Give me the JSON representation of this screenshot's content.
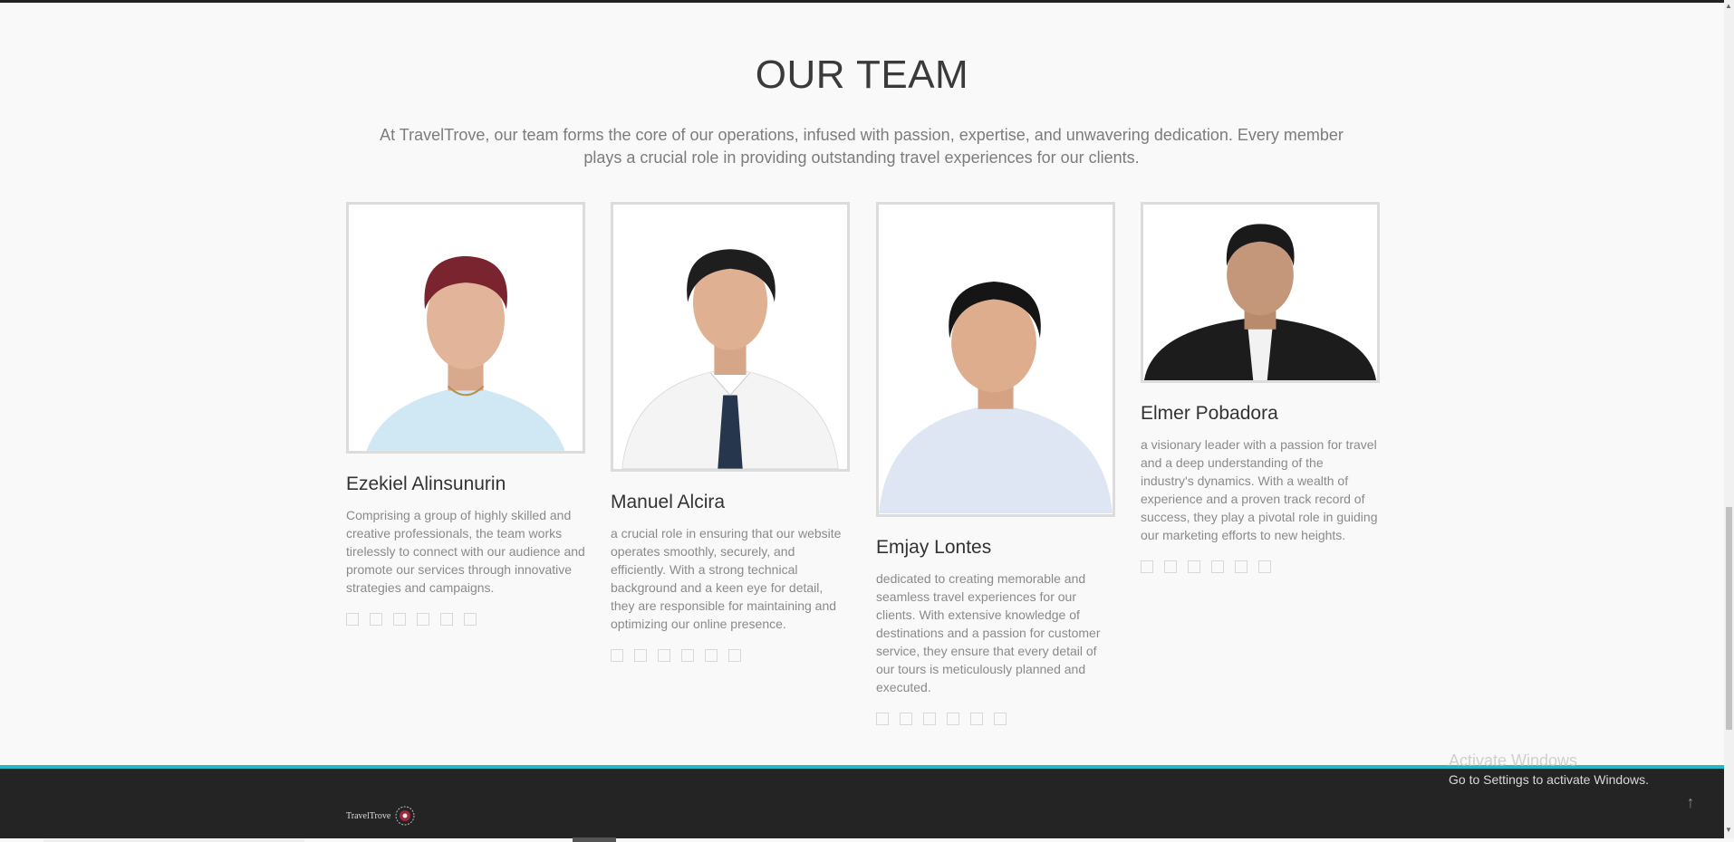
{
  "section": {
    "title": "OUR TEAM",
    "intro": "At TravelTrove, our team forms the core of our operations, infused with passion, expertise, and unwavering dedication. Every member plays a crucial role in providing outstanding travel experiences for our clients."
  },
  "members": [
    {
      "name": "Ezekiel Alinsunurin",
      "bio": "Comprising a group of highly skilled and creative professionals, the team works tirelessly to connect with our audience and promote our services through innovative strategies and campaigns.",
      "hair_color": "#7a2430",
      "shirt_color": "#cfe8f3"
    },
    {
      "name": "Manuel Alcira",
      "bio": "a crucial role in ensuring that our website operates smoothly, securely, and efficiently. With a strong technical background and a keen eye for detail, they are responsible for maintaining and optimizing our online presence.",
      "hair_color": "#1e1e1e",
      "shirt_color": "#f4f4f4"
    },
    {
      "name": "Emjay Lontes",
      "bio": "dedicated to creating memorable and seamless travel experiences for our clients. With extensive knowledge of destinations and a passion for customer service, they ensure that every detail of our tours is meticulously planned and executed.",
      "hair_color": "#151515",
      "shirt_color": "#dfe6f3"
    },
    {
      "name": "Elmer Pobadora",
      "bio": "a visionary leader with a passion for travel and a deep understanding of the industry's dynamics. With a wealth of experience and a proven track record of success, they play a pivotal role in guiding our marketing efforts to new heights.",
      "hair_color": "#1a1a1a",
      "shirt_color": "#1c1c1c"
    }
  ],
  "social_icons": [
    "facebook-icon",
    "twitter-icon",
    "instagram-icon",
    "linkedin-icon",
    "youtube-icon",
    "github-icon"
  ],
  "footer": {
    "logo_text": "TravelTrove",
    "accent_color": "#22b8c4"
  },
  "windows_watermark": {
    "title": "Activate Windows",
    "subtitle": "Go to Settings to activate Windows."
  }
}
